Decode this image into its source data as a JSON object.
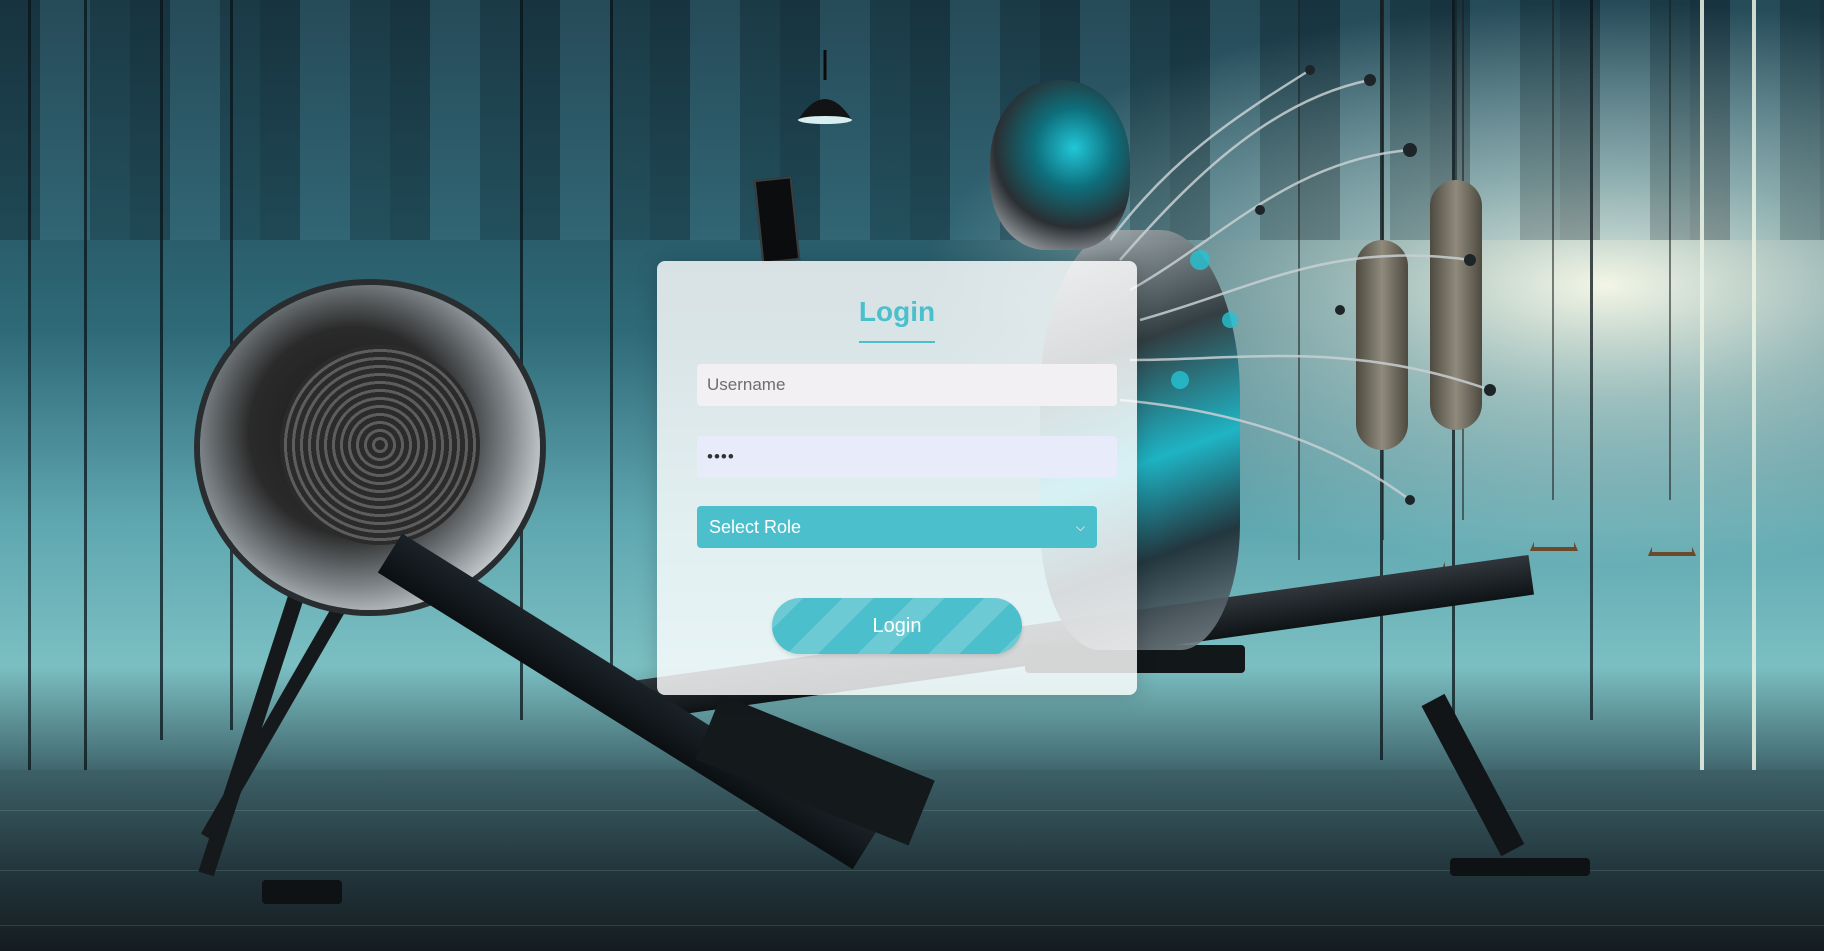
{
  "login": {
    "title": "Login",
    "username_placeholder": "Username",
    "password_value": "••••",
    "role_select_label": "Select Role",
    "submit_label": "Login"
  },
  "colors": {
    "accent": "#4cbfcc",
    "card_bg": "#ffffff"
  },
  "icons": {
    "select_chevron": "chevron-down-icon"
  }
}
